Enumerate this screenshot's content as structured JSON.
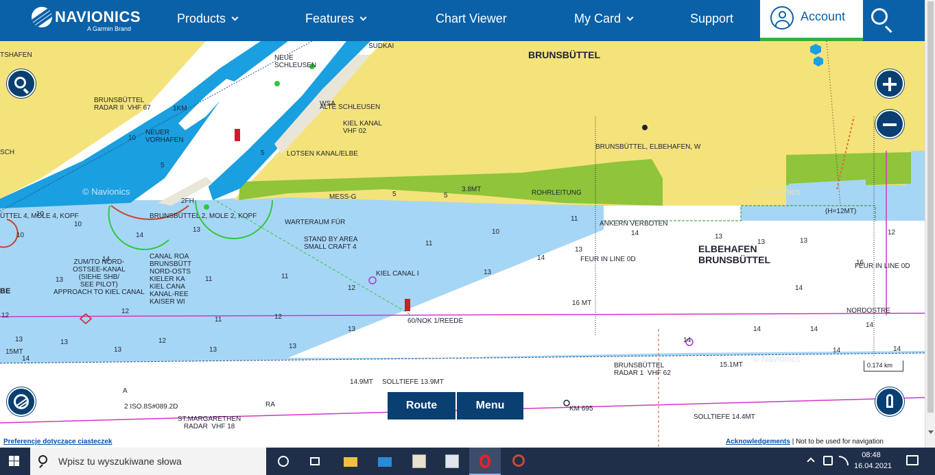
{
  "nav": {
    "logo_text": "NAVIONICS",
    "logo_sub": "A Garmin Brand",
    "items": [
      {
        "label": "Products",
        "dropdown": true
      },
      {
        "label": "Features",
        "dropdown": true
      },
      {
        "label": "Chart Viewer",
        "dropdown": false
      },
      {
        "label": "My Card",
        "dropdown": true
      },
      {
        "label": "Support",
        "dropdown": false
      }
    ],
    "account_label": "Account",
    "accent": "#0a61a8",
    "account_underline": "#31b33c"
  },
  "map": {
    "colors": {
      "land": "#f4e37a",
      "shallow": "#a6d6f5",
      "deep": "#ffffff",
      "channel": "#1a9fe0",
      "marsh": "#8fc43b",
      "route": "#d633c8"
    },
    "labels": {
      "brunsbuttel": "BRUNSBÜTTEL",
      "elbehafen1": "ELBEHAFEN",
      "elbehafen2": "BRUNSBÜTTEL",
      "shafen": "TSHAFEN",
      "neue_schleusen": "NEUE\nSCHLEUSEN",
      "sudkai": "SUDKAI",
      "radar2": "BRUNSBÜTTEL\nRADAR II  VHF 67",
      "km1": "1KM",
      "neuer_vorhafen": "NEUER\nVORHAFEN",
      "wsa": "WSA",
      "alte_schleusen": "ALTE SCHLEUSEN",
      "kiel_kanal_vhf": "KIEL KANAL\nVHF 02",
      "lotsen": "LOTSEN KANAL/ELBE",
      "elbehafen_w": "BRUNSBÜTTEL, ELBEHAFEN, W",
      "rohrleitung": "ROHRLEITUNG",
      "h12": "(H=12MT)",
      "mole4": "ÜTTEL 4, MOLE 4, KOPF",
      "mole2": "BRUNSBÜTTEL 2, MOLE 2, KOPF",
      "fh": "2FH",
      "messg": "MESS-G",
      "mt38": "3.8MT",
      "warteraum": "WARTERAUM FÜR",
      "standby": "STAND BY AREA\nSMALL CRAFT 4",
      "ankern": "ANKERN  VERBOTEN",
      "feur1": "FEUR IN LINE 0D",
      "feur2": "FEUR IN LINE 0D",
      "zum": "ZUM/TO NORD-\nOSTSEE-KANAL\n(SIEHE SHB/\nSEE PILOT)\nAPPROACH TO KIEL CANAL",
      "canal_roa": "CANAL ROA\nBRUNSBÜTT\nNORD-OSTS\nKIELER KA\nKIEL CANA\nKANAL-REE\nKAISER WI",
      "kiel_canal_i": "KIEL CANAL I",
      "mt16": "16 MT",
      "nordostre": "NORDOSTRE",
      "reede": "60/NOK 1/REEDE",
      "be": "BE",
      "sch": "SCH",
      "mt15": "15MT",
      "radar1": "BRUNSBÜTTEL\nRADAR 1  VHF 62",
      "mt151": "15.1MT",
      "mt149": "14.9MT",
      "solltiefe1": "SOLLTIEFE 13.9MT",
      "solltiefe2": "SOLLTIEFE 14.4MT",
      "iso": "2 ISO.8S#089.2D",
      "ra": "RA",
      "a": "A",
      "stmargarethen": "ST.MARGARETHEN\nRADAR  VHF 18",
      "km695": "KM 695"
    },
    "depths": [
      [
        "10",
        187,
        136
      ],
      [
        "5",
        234,
        176
      ],
      [
        "5",
        380,
        158
      ],
      [
        "5",
        572,
        218
      ],
      [
        "5",
        647,
        220
      ],
      [
        "10",
        53,
        247
      ],
      [
        "10",
        108,
        262
      ],
      [
        "10",
        24,
        278
      ],
      [
        "14",
        198,
        278
      ],
      [
        "13",
        281,
        270
      ],
      [
        "11",
        620,
        290
      ],
      [
        "10",
        717,
        273
      ],
      [
        "11",
        832,
        254
      ],
      [
        "13",
        838,
        299
      ],
      [
        "14",
        783,
        311
      ],
      [
        "14",
        920,
        275
      ],
      [
        "13",
        1042,
        280
      ],
      [
        "13",
        1104,
        288
      ],
      [
        "13",
        1166,
        286
      ],
      [
        "12",
        1294,
        274
      ],
      [
        "16",
        1248,
        318
      ],
      [
        "14",
        149,
        313
      ],
      [
        "11",
        299,
        342
      ],
      [
        "11",
        410,
        338
      ],
      [
        "13",
        705,
        332
      ],
      [
        "12",
        507,
        355
      ],
      [
        "14",
        1159,
        355
      ],
      [
        "12",
        177,
        389
      ],
      [
        "11",
        313,
        401
      ],
      [
        "12",
        400,
        397
      ],
      [
        "13",
        507,
        415
      ],
      [
        "12",
        2,
        395
      ],
      [
        "13",
        22,
        430
      ],
      [
        "13",
        88,
        434
      ],
      [
        "14",
        32,
        458
      ],
      [
        "12",
        231,
        432
      ],
      [
        "13",
        166,
        445
      ],
      [
        "13",
        305,
        445
      ],
      [
        "13",
        421,
        440
      ],
      [
        "14",
        996,
        431
      ],
      [
        "14",
        1098,
        415
      ],
      [
        "14",
        1181,
        415
      ],
      [
        "14",
        1262,
        409
      ],
      [
        "14",
        1214,
        446
      ],
      [
        "14",
        1302,
        444
      ],
      [
        "13",
        81,
        343
      ]
    ],
    "watermark": "© Navionics"
  },
  "route_button": "Route",
  "menu_button": "Menu",
  "scale": "0.174   km",
  "footer": {
    "cookies": "Preferencje dotyczące ciasteczek",
    "acknowledgements": "Acknowledgements",
    "not_for_nav": " | Not to be used for navigation"
  },
  "taskbar": {
    "search_placeholder": "Wpisz tu wyszukiwane słowa",
    "time": "08:48",
    "date": "16.04.2021"
  }
}
